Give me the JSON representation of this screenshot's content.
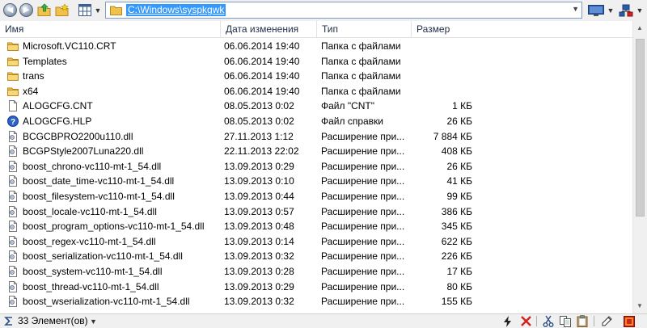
{
  "address": {
    "path": "C:\\Windows\\syspkgwk"
  },
  "columns": {
    "name": "Имя",
    "date": "Дата изменения",
    "type": "Тип",
    "size": "Размер"
  },
  "files": [
    {
      "name": "Microsoft.VC110.CRT",
      "date": "06.06.2014 19:40",
      "type": "Папка с файлами",
      "size": "",
      "icon": "folder-icon"
    },
    {
      "name": "Templates",
      "date": "06.06.2014 19:40",
      "type": "Папка с файлами",
      "size": "",
      "icon": "folder-icon"
    },
    {
      "name": "trans",
      "date": "06.06.2014 19:40",
      "type": "Папка с файлами",
      "size": "",
      "icon": "folder-icon"
    },
    {
      "name": "x64",
      "date": "06.06.2014 19:40",
      "type": "Папка с файлами",
      "size": "",
      "icon": "folder-icon"
    },
    {
      "name": "ALOGCFG.CNT",
      "date": "08.05.2013 0:02",
      "type": "Файл \"CNT\"",
      "size": "1 КБ",
      "icon": "file-icon"
    },
    {
      "name": "ALOGCFG.HLP",
      "date": "08.05.2013 0:02",
      "type": "Файл справки",
      "size": "26 КБ",
      "icon": "help-icon"
    },
    {
      "name": "BCGCBPRO2200u110.dll",
      "date": "27.11.2013 1:12",
      "type": "Расширение при...",
      "size": "7 884 КБ",
      "icon": "dll-icon"
    },
    {
      "name": "BCGPStyle2007Luna220.dll",
      "date": "22.11.2013 22:02",
      "type": "Расширение при...",
      "size": "408 КБ",
      "icon": "dll-icon"
    },
    {
      "name": "boost_chrono-vc110-mt-1_54.dll",
      "date": "13.09.2013 0:29",
      "type": "Расширение при...",
      "size": "26 КБ",
      "icon": "dll-icon"
    },
    {
      "name": "boost_date_time-vc110-mt-1_54.dll",
      "date": "13.09.2013 0:10",
      "type": "Расширение при...",
      "size": "41 КБ",
      "icon": "dll-icon"
    },
    {
      "name": "boost_filesystem-vc110-mt-1_54.dll",
      "date": "13.09.2013 0:44",
      "type": "Расширение при...",
      "size": "99 КБ",
      "icon": "dll-icon"
    },
    {
      "name": "boost_locale-vc110-mt-1_54.dll",
      "date": "13.09.2013 0:57",
      "type": "Расширение при...",
      "size": "386 КБ",
      "icon": "dll-icon"
    },
    {
      "name": "boost_program_options-vc110-mt-1_54.dll",
      "date": "13.09.2013 0:48",
      "type": "Расширение при...",
      "size": "345 КБ",
      "icon": "dll-icon"
    },
    {
      "name": "boost_regex-vc110-mt-1_54.dll",
      "date": "13.09.2013 0:14",
      "type": "Расширение при...",
      "size": "622 КБ",
      "icon": "dll-icon"
    },
    {
      "name": "boost_serialization-vc110-mt-1_54.dll",
      "date": "13.09.2013 0:32",
      "type": "Расширение при...",
      "size": "226 КБ",
      "icon": "dll-icon"
    },
    {
      "name": "boost_system-vc110-mt-1_54.dll",
      "date": "13.09.2013 0:28",
      "type": "Расширение при...",
      "size": "17 КБ",
      "icon": "dll-icon"
    },
    {
      "name": "boost_thread-vc110-mt-1_54.dll",
      "date": "13.09.2013 0:29",
      "type": "Расширение при...",
      "size": "80 КБ",
      "icon": "dll-icon"
    },
    {
      "name": "boost_wserialization-vc110-mt-1_54.dll",
      "date": "13.09.2013 0:32",
      "type": "Расширение при...",
      "size": "155 КБ",
      "icon": "dll-icon"
    }
  ],
  "status": {
    "count": "33 Элемент(ов)"
  },
  "colors": {
    "selection": "#3399ff",
    "folder": "#f0c24b",
    "help": "#2a62c9",
    "delete": "#d42020"
  }
}
